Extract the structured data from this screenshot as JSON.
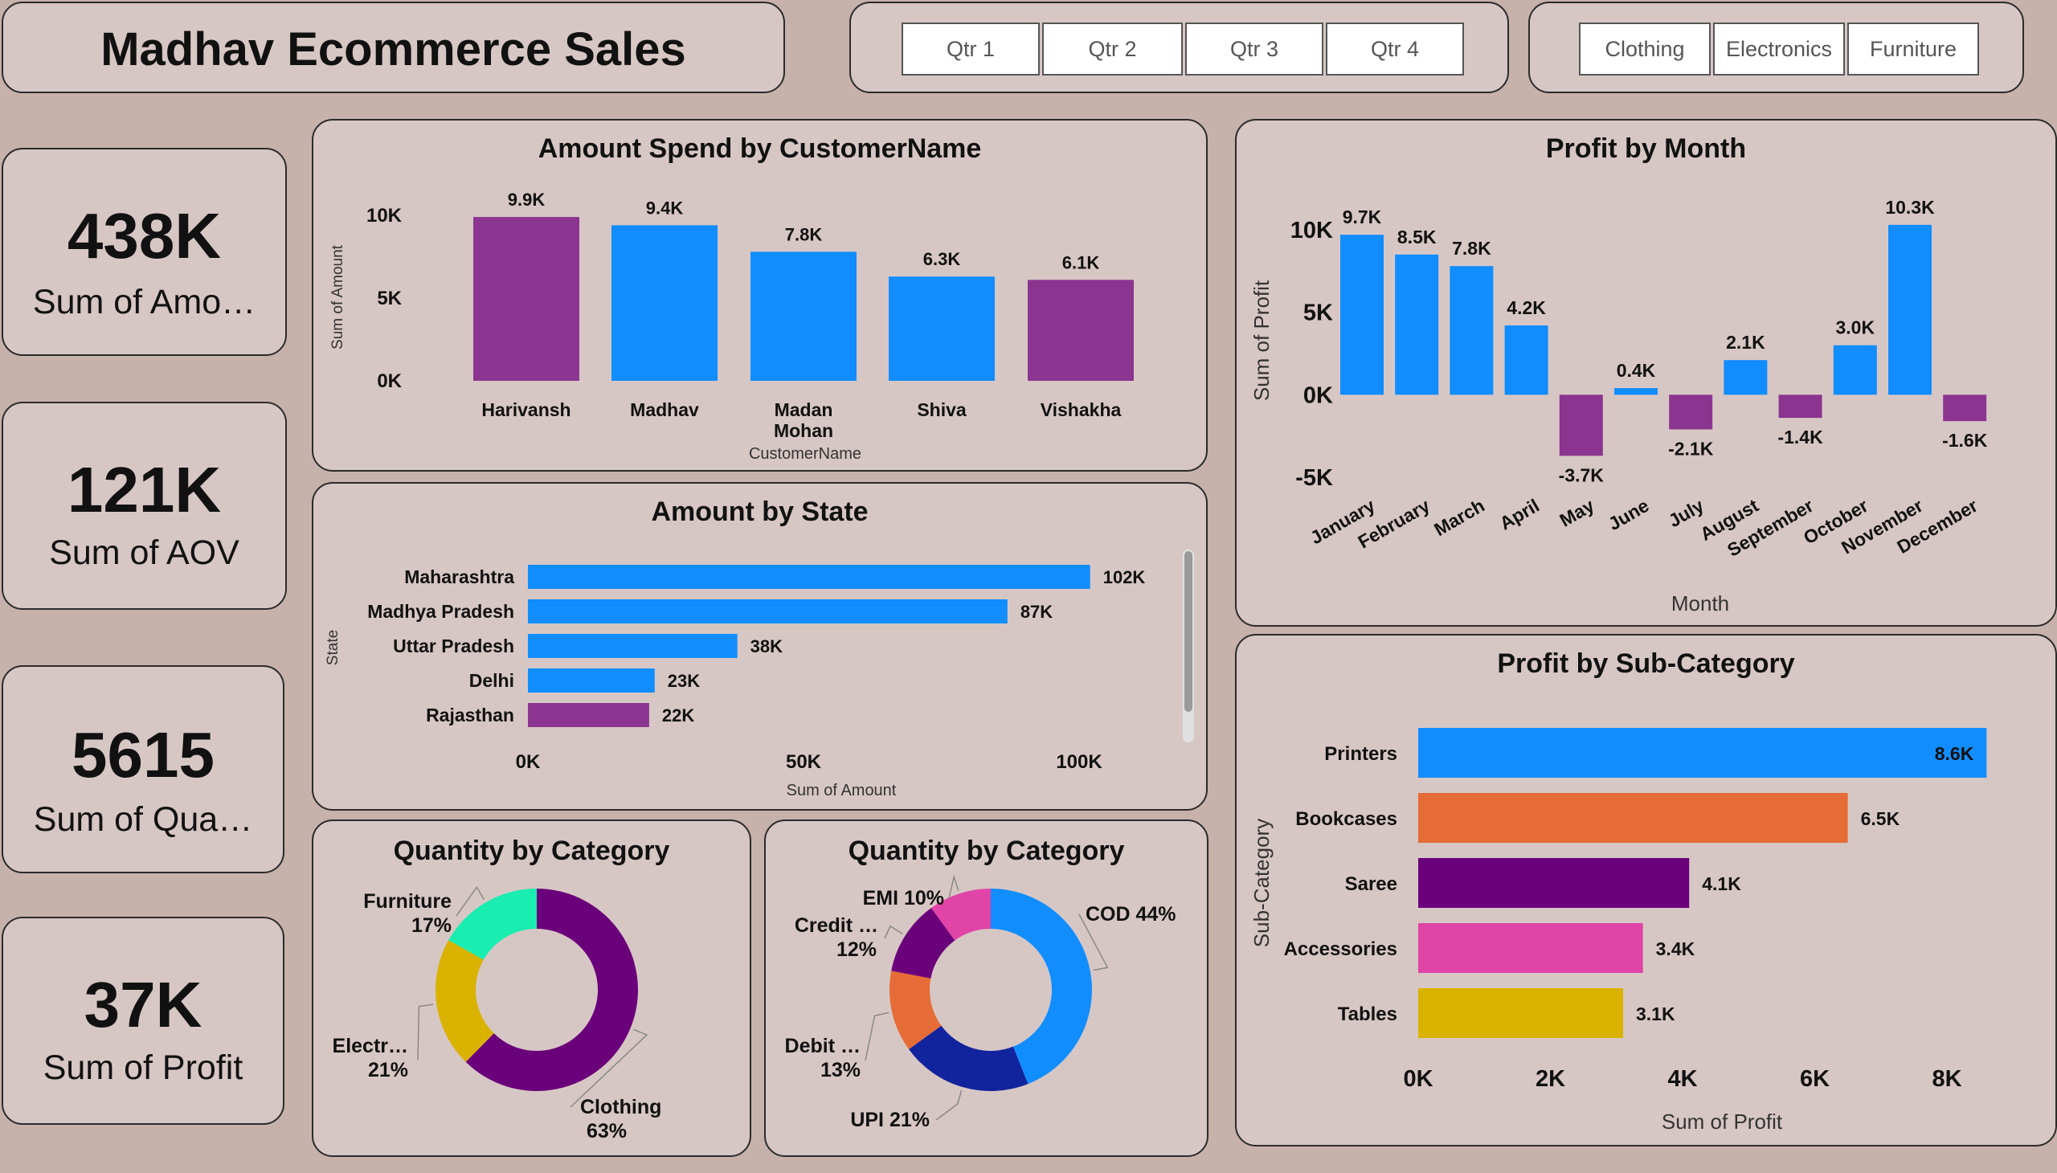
{
  "header": {
    "title": "Madhav Ecommerce Sales"
  },
  "quarter_slicer": {
    "options": [
      "Qtr 1",
      "Qtr 2",
      "Qtr 3",
      "Qtr 4"
    ]
  },
  "category_slicer": {
    "options": [
      "Clothing",
      "Electronics",
      "Furniture"
    ]
  },
  "kpis": [
    {
      "value": "438K",
      "label": "Sum of Amo…"
    },
    {
      "value": "121K",
      "label": "Sum of AOV"
    },
    {
      "value": "5615",
      "label": "Sum of Qua…"
    },
    {
      "value": "37K",
      "label": "Sum of Profit"
    }
  ],
  "colors": {
    "blue": "#118dff",
    "purple": "#8b3591",
    "orange": "#e66c37",
    "dark_purple": "#6b007b",
    "pink": "#e044a7",
    "gold": "#d9b300",
    "mint": "#1aedb0",
    "navy": "#12239e"
  },
  "chart_data": [
    {
      "type": "bar",
      "title": "Amount Spend by CustomerName",
      "xlabel": "CustomerName",
      "ylabel": "Sum of Amount",
      "categories": [
        "Harivansh",
        "Madhav",
        "Madan Mohan",
        "Shiva",
        "Vishakha"
      ],
      "values": [
        9900,
        9400,
        7800,
        6300,
        6100
      ],
      "data_labels": [
        "9.9K",
        "9.4K",
        "7.8K",
        "6.3K",
        "6.1K"
      ],
      "bar_colors": [
        "#8b3591",
        "#118dff",
        "#118dff",
        "#118dff",
        "#8b3591"
      ],
      "yticks": [
        "0K",
        "5K",
        "10K"
      ],
      "ylim": [
        0,
        10000
      ]
    },
    {
      "type": "bar",
      "orientation": "horizontal",
      "title": "Amount by State",
      "xlabel": "Sum of Amount",
      "ylabel": "State",
      "categories": [
        "Maharashtra",
        "Madhya Pradesh",
        "Uttar Pradesh",
        "Delhi",
        "Rajasthan"
      ],
      "values": [
        102000,
        87000,
        38000,
        23000,
        22000
      ],
      "data_labels": [
        "102K",
        "87K",
        "38K",
        "23K",
        "22K"
      ],
      "bar_colors": [
        "#118dff",
        "#118dff",
        "#118dff",
        "#118dff",
        "#8b3591"
      ],
      "xticks": [
        "0K",
        "50K",
        "100K"
      ],
      "xlim": [
        0,
        100000
      ]
    },
    {
      "type": "bar",
      "title": "Profit by Month",
      "xlabel": "Month",
      "ylabel": "Sum of Profit",
      "categories": [
        "January",
        "February",
        "March",
        "April",
        "May",
        "June",
        "July",
        "August",
        "September",
        "October",
        "November",
        "December"
      ],
      "values": [
        9700,
        8500,
        7800,
        4200,
        -3700,
        400,
        -2100,
        2100,
        -1400,
        3000,
        10300,
        -1600
      ],
      "data_labels": [
        "9.7K",
        "8.5K",
        "7.8K",
        "4.2K",
        "-3.7K",
        "0.4K",
        "-2.1K",
        "2.1K",
        "-1.4K",
        "3.0K",
        "10.3K",
        "-1.6K"
      ],
      "yticks": [
        "-5K",
        "0K",
        "5K",
        "10K"
      ],
      "ylim": [
        -5000,
        10000
      ],
      "positive_color": "#118dff",
      "negative_color": "#8b3591"
    },
    {
      "type": "bar",
      "orientation": "horizontal",
      "title": "Profit by Sub-Category",
      "xlabel": "Sum of Profit",
      "ylabel": "Sub-Category",
      "categories": [
        "Printers",
        "Bookcases",
        "Saree",
        "Accessories",
        "Tables"
      ],
      "values": [
        8600,
        6500,
        4100,
        3400,
        3100
      ],
      "data_labels": [
        "8.6K",
        "6.5K",
        "4.1K",
        "3.4K",
        "3.1K"
      ],
      "bar_colors": [
        "#118dff",
        "#e66c37",
        "#6b007b",
        "#e044a7",
        "#d9b300"
      ],
      "xticks": [
        "0K",
        "2K",
        "4K",
        "6K",
        "8K"
      ],
      "xlim": [
        0,
        8000
      ]
    },
    {
      "type": "pie",
      "donut": true,
      "title": "Quantity by Category",
      "labels": [
        "Clothing",
        "Electr…",
        "Furniture"
      ],
      "values": [
        63,
        21,
        17
      ],
      "value_labels": [
        "63%",
        "21%",
        "17%"
      ],
      "colors": [
        "#6b007b",
        "#d9b300",
        "#1aedb0"
      ]
    },
    {
      "type": "pie",
      "donut": true,
      "title": "Quantity by Category",
      "labels": [
        "COD",
        "UPI",
        "Debit …",
        "Credit …",
        "EMI"
      ],
      "values": [
        44,
        21,
        13,
        12,
        10
      ],
      "value_labels": [
        "44%",
        "21%",
        "13%",
        "12%",
        "10%"
      ],
      "colors": [
        "#118dff",
        "#12239e",
        "#e66c37",
        "#6b007b",
        "#e044a7"
      ]
    }
  ]
}
